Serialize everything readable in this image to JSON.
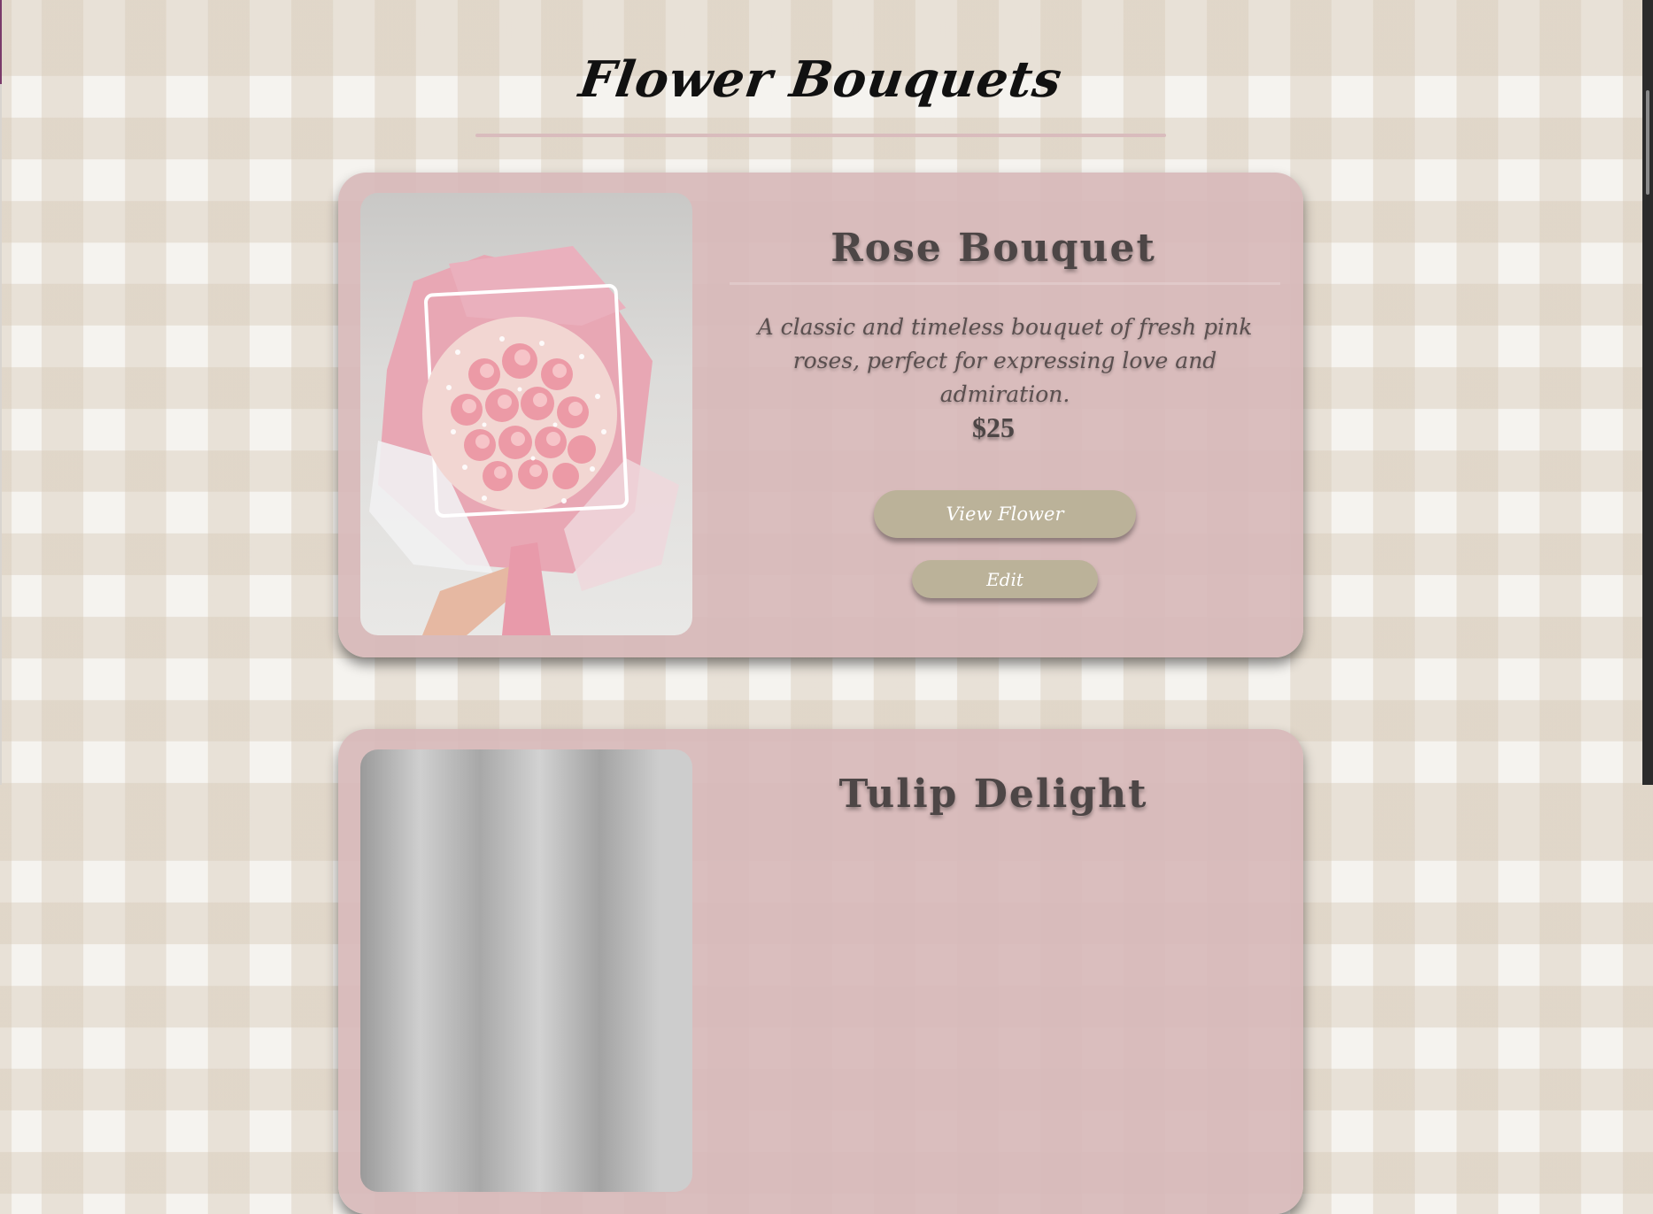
{
  "page": {
    "title": "Flower Bouquets"
  },
  "products": [
    {
      "name": "Rose Bouquet",
      "description": "A classic and timeless bouquet of fresh pink roses, perfect for expressing love and admiration.",
      "price": "$25",
      "view_button": "View Flower",
      "edit_button": "Edit"
    },
    {
      "name": "Tulip Delight"
    }
  ],
  "colors": {
    "card_background": "#d8babb",
    "button": "#bbb299",
    "heading_text": "#4d4646",
    "title_divider": "#d9bcbd"
  }
}
